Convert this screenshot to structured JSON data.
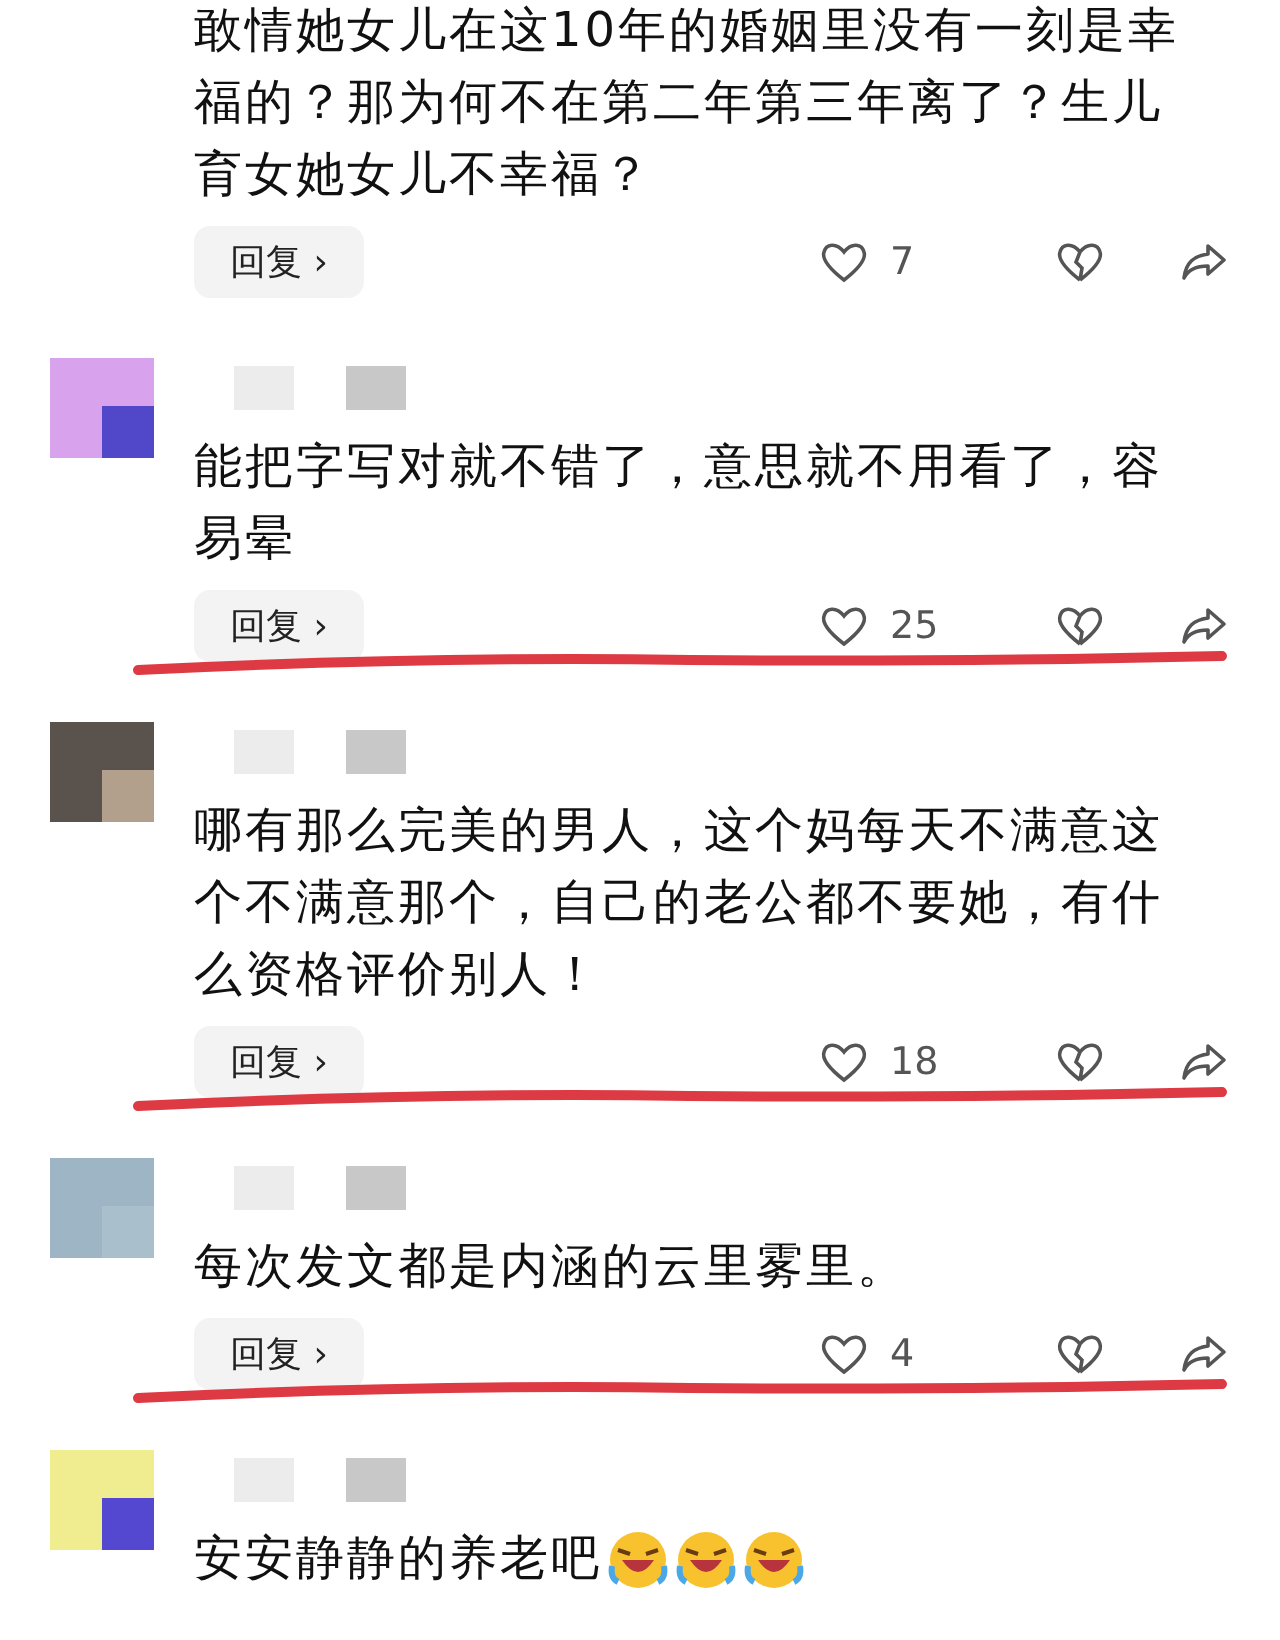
{
  "comments": [
    {
      "show_header": false,
      "text": "敢情她女儿在这10年的婚姻里没有一刻是幸福的？那为何不在第二年第三年离了？生儿育女她女儿不幸福？",
      "reply": "回复 ›",
      "likes": "7",
      "marked": false
    },
    {
      "show_header": true,
      "text": "能把字写对就不错了，意思就不用看了，容易晕",
      "reply": "回复 ›",
      "likes": "25",
      "marked": true
    },
    {
      "show_header": true,
      "text": "哪有那么完美的男人，这个妈每天不满意这个不满意那个，自己的老公都不要她，有什么资格评价别人！",
      "reply": "回复 ›",
      "likes": "18",
      "marked": true
    },
    {
      "show_header": true,
      "text": "每次发文都是内涵的云里雾里。",
      "reply": "回复 ›",
      "likes": "4",
      "marked": true
    },
    {
      "show_header": true,
      "text": "安安静静的养老吧",
      "emojis": [
        {
          "kind": "laughing"
        },
        {
          "kind": "laughing"
        },
        {
          "kind": "laughing"
        }
      ],
      "marked": false
    }
  ]
}
